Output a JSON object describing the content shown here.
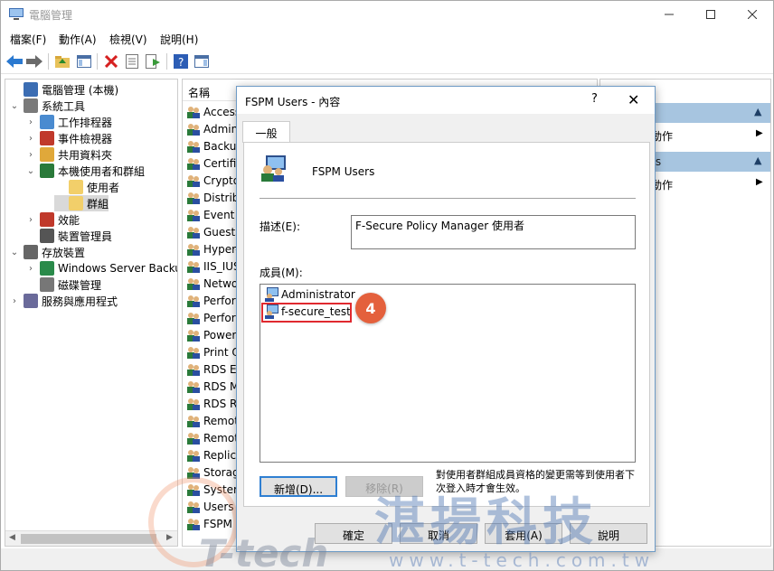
{
  "window": {
    "title": "電腦管理"
  },
  "menu": [
    "檔案(F)",
    "動作(A)",
    "檢視(V)",
    "說明(H)"
  ],
  "tree": [
    {
      "label": "電腦管理 (本機)",
      "expander": "",
      "icon": "computer-icon"
    },
    {
      "label": "系統工具",
      "expander": "⌄",
      "icon": "tools-icon"
    },
    {
      "label": "工作排程器",
      "expander": "›",
      "icon": "clock-icon"
    },
    {
      "label": "事件檢視器",
      "expander": "›",
      "icon": "event-viewer-icon"
    },
    {
      "label": "共用資料夾",
      "expander": "›",
      "icon": "shared-folder-icon"
    },
    {
      "label": "本機使用者和群組",
      "expander": "⌄",
      "icon": "users-icon"
    },
    {
      "label": "使用者",
      "expander": "",
      "icon": "folder-icon"
    },
    {
      "label": "群組",
      "expander": "",
      "icon": "folder-icon"
    },
    {
      "label": "效能",
      "expander": "›",
      "icon": "performance-icon"
    },
    {
      "label": "裝置管理員",
      "expander": "",
      "icon": "device-manager-icon"
    },
    {
      "label": "存放裝置",
      "expander": "⌄",
      "icon": "storage-icon"
    },
    {
      "label": "Windows Server Backu",
      "expander": "›",
      "icon": "backup-icon"
    },
    {
      "label": "磁碟管理",
      "expander": "",
      "icon": "disk-icon"
    },
    {
      "label": "服務與應用程式",
      "expander": "›",
      "icon": "services-icon"
    }
  ],
  "list": {
    "header": "名稱",
    "items": [
      "Access",
      "Admini",
      "Backup",
      "Certific",
      "Crypto",
      "Distribu",
      "Event L",
      "Guests",
      "Hyper-",
      "IIS_IUSI",
      "Netwo",
      "Perforn",
      "Perforn",
      "Power",
      "Print O",
      "RDS En",
      "RDS M",
      "RDS Re",
      "Remot",
      "Remot",
      "Replica",
      "Storag",
      "System",
      "Users",
      "FSPM U"
    ]
  },
  "actions": {
    "header1": "",
    "row1": "動作",
    "header2": "rs",
    "row2": "動作"
  },
  "dialog": {
    "title": "FSPM Users - 內容",
    "help": "?",
    "close": "✕",
    "tab": "一般",
    "group_name": "FSPM Users",
    "description_label": "描述(E):",
    "description_value": "F-Secure Policy Manager 使用者",
    "members_label": "成員(M):",
    "members": [
      "Administrator",
      "f-secure_test"
    ],
    "step_badge": "4",
    "add_button": "新增(D)...",
    "remove_button": "移除(R)",
    "note": "對使用者群組成員資格的變更需等到使用者下次登入時才會生效。",
    "ok_button": "確定",
    "cancel_button": "取消",
    "apply_button": "套用(A)",
    "help_button": "說明"
  },
  "watermark": {
    "brand_cn": "湛揚科技",
    "brand_logo": "T-tech",
    "url": "www.t-tech.com.tw"
  }
}
